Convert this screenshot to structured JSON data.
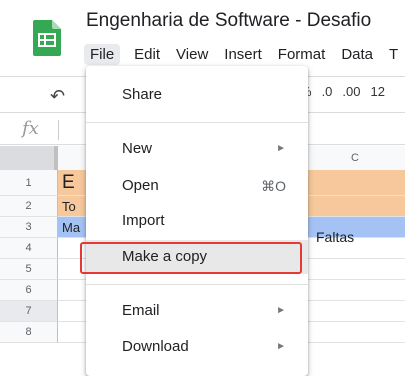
{
  "header": {
    "title": "Engenharia de Software - Desafio",
    "menubar": [
      "File",
      "Edit",
      "View",
      "Insert",
      "Format",
      "Data",
      "T"
    ]
  },
  "toolbar": {
    "percent": "%",
    "dec_decrease": ".0",
    "dec_increase": ".00",
    "format_more": "12"
  },
  "formula_bar": {
    "fx": "fx"
  },
  "grid": {
    "column_c": "C",
    "rows": [
      "1",
      "2",
      "3",
      "4",
      "5",
      "6",
      "7",
      "8"
    ],
    "cells": {
      "a1": "E",
      "a2": "To",
      "a3": "Ma",
      "c3": "Faltas"
    },
    "colors": {
      "row1": "#f6c89b",
      "row3": "#a4c2f4"
    }
  },
  "file_menu": {
    "items": [
      {
        "label": "Share"
      },
      {
        "label": "New",
        "arrow": "►"
      },
      {
        "label": "Open",
        "shortcut": "⌘O"
      },
      {
        "label": "Import"
      },
      {
        "label": "Make a copy"
      },
      {
        "label": "Email",
        "arrow": "►"
      },
      {
        "label": "Download",
        "arrow": "►"
      }
    ]
  },
  "colors": {
    "callout": "#e53935",
    "logo": "#34a853"
  }
}
